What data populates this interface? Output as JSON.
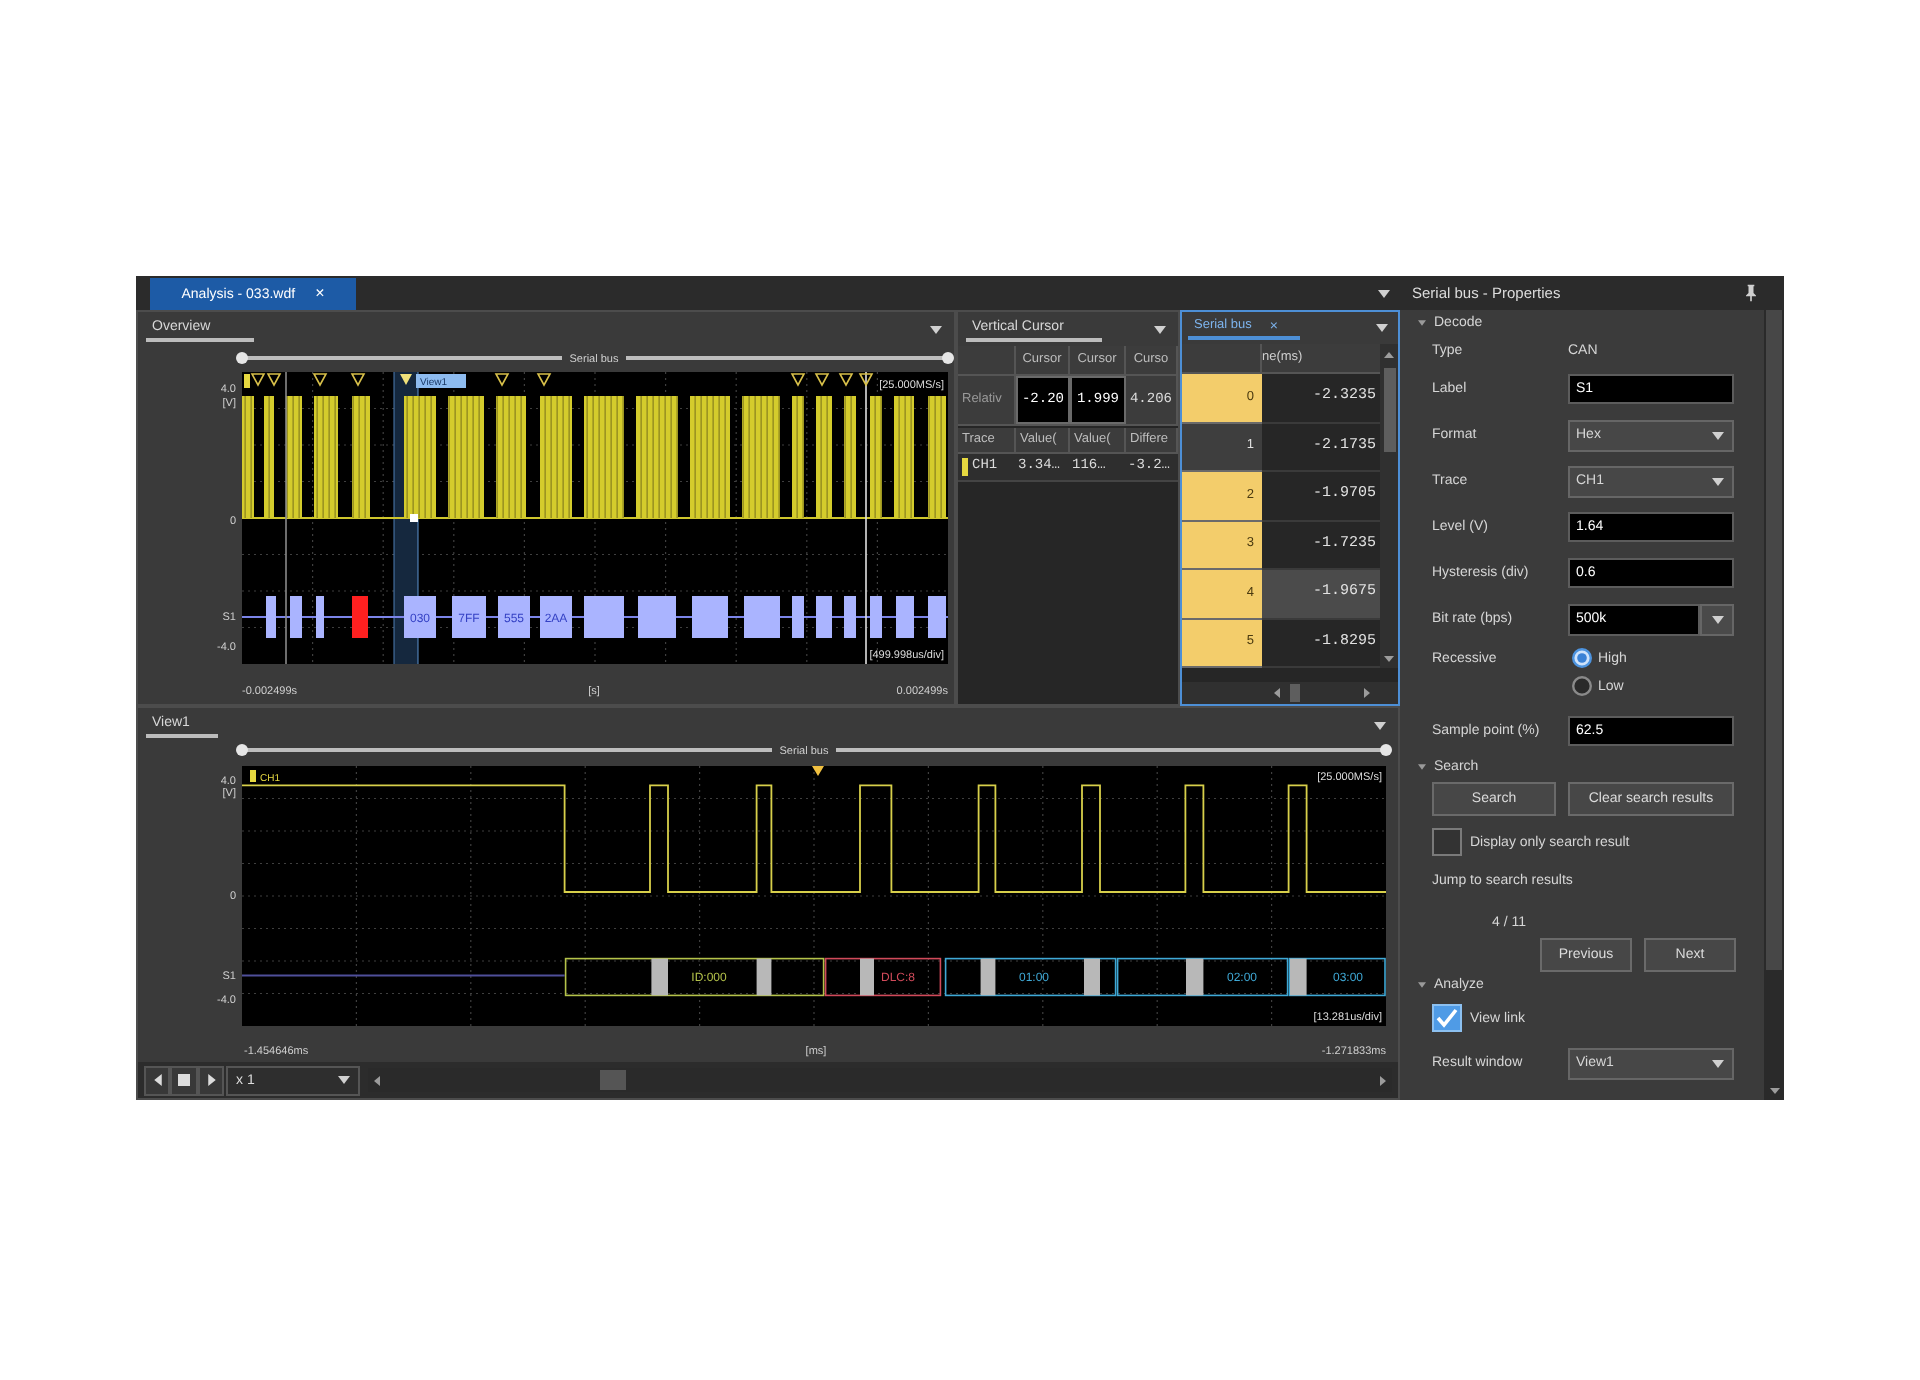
{
  "document_tabs": [
    {
      "label": "Analysis - 033.wdf",
      "close": "×",
      "selected": true
    }
  ],
  "overview": {
    "tab": "Overview",
    "bus_label": "Serial bus",
    "y_labels": [
      "4.0",
      "[V]",
      "0",
      "S1",
      "-4.0"
    ],
    "sample_rate": "[25.000MS/s]",
    "time_div": "[499.998us/div]",
    "cursor_tag": "View1",
    "x_labels": [
      "-0.002499s",
      "[s]",
      "0.002499s"
    ],
    "frames": [
      {
        "color": "#aab4ff"
      },
      {
        "color": "#aab4ff"
      },
      {
        "color": "#aab4ff"
      },
      {
        "color": "#ff2020"
      },
      {
        "label": "030",
        "color": "#aab4ff"
      },
      {
        "label": "7FF",
        "color": "#aab4ff"
      },
      {
        "label": "555",
        "color": "#aab4ff"
      },
      {
        "label": "2AA",
        "color": "#aab4ff"
      },
      {
        "color": "#aab4ff"
      },
      {
        "color": "#aab4ff"
      },
      {
        "color": "#aab4ff"
      },
      {
        "color": "#aab4ff"
      },
      {
        "color": "#aab4ff"
      },
      {
        "color": "#aab4ff"
      },
      {
        "color": "#aab4ff"
      },
      {
        "color": "#aab4ff"
      },
      {
        "color": "#aab4ff"
      },
      {
        "color": "#aab4ff"
      }
    ]
  },
  "vertical_cursor": {
    "tab": "Vertical Cursor",
    "cursor_columns": [
      "Cursor",
      "Cursor",
      "Curso"
    ],
    "cursor_rows": [
      {
        "label": "Relativ",
        "cells": [
          {
            "text": "-2.20",
            "selected": true
          },
          {
            "text": "1.999",
            "selected": true
          },
          {
            "text": "4.206",
            "selected": false
          }
        ]
      }
    ],
    "trace_columns": [
      "Trace",
      "Value(",
      "Value(",
      "Differe"
    ],
    "trace_rows": [
      {
        "trace": "CH1",
        "color": "#e6d840",
        "cells": [
          "3.34…",
          "116…",
          "-3.2…"
        ]
      }
    ]
  },
  "serial_bus": {
    "tab": "Serial bus",
    "close": "×",
    "column": "ne(ms)",
    "rows": [
      {
        "index": "0",
        "time": "-2.3235",
        "focused": false,
        "selected": false
      },
      {
        "index": "1",
        "time": "-2.1735",
        "focused": true,
        "selected": false
      },
      {
        "index": "2",
        "time": "-1.9705",
        "focused": false,
        "selected": false
      },
      {
        "index": "3",
        "time": "-1.7235",
        "focused": false,
        "selected": false
      },
      {
        "index": "4",
        "time": "-1.9675",
        "focused": false,
        "selected": true
      },
      {
        "index": "5",
        "time": "-1.8295",
        "focused": false,
        "selected": false
      }
    ]
  },
  "view1": {
    "tab": "View1",
    "bus_label": "Serial bus",
    "y_labels": [
      "4.0",
      "[V]",
      "0",
      "S1",
      "-4.0"
    ],
    "trace_label": "CH1",
    "sample_rate": "[25.000MS/s]",
    "time_div": "[13.281us/div]",
    "x_labels": [
      "-1.454646ms",
      "[ms]",
      "-1.271833ms"
    ],
    "frames": [
      {
        "label": "ID:000",
        "color": "#b4c24a"
      },
      {
        "label": "DLC:8",
        "color": "#d04a5a"
      },
      {
        "label": "01:00",
        "color": "#3fa9d6"
      },
      {
        "label": "02:00",
        "color": "#3fa9d6"
      },
      {
        "label": "03:00",
        "color": "#3fa9d6"
      }
    ]
  },
  "view_toolbar": {
    "zoom": "x 1"
  },
  "properties": {
    "title": "Serial bus - Properties",
    "sections": [
      {
        "title": "Decode",
        "expanded": true,
        "rows": [
          {
            "kind": "text",
            "label": "Type",
            "value": "CAN"
          },
          {
            "kind": "input",
            "label": "Label",
            "value": "S1"
          },
          {
            "kind": "select",
            "label": "Format",
            "value": "Hex"
          },
          {
            "kind": "select",
            "label": "Trace",
            "value": "CH1"
          },
          {
            "kind": "input",
            "label": "Level (V)",
            "value": "1.64"
          },
          {
            "kind": "input",
            "label": "Hysteresis (div)",
            "value": "0.6"
          },
          {
            "kind": "combo",
            "label": "Bit rate (bps)",
            "value": "500k"
          },
          {
            "kind": "radio",
            "label": "Recessive",
            "options": [
              {
                "label": "High",
                "selected": true
              },
              {
                "label": "Low",
                "selected": false
              }
            ]
          },
          {
            "kind": "input",
            "label": "Sample point (%)",
            "value": "62.5"
          }
        ]
      },
      {
        "title": "Search",
        "expanded": true,
        "rows": [
          {
            "kind": "buttons",
            "buttons": [
              "Search",
              "Clear search results"
            ]
          },
          {
            "kind": "checkbox",
            "label": "Display only search result",
            "checked": false
          },
          {
            "kind": "note",
            "label": "Jump to search results"
          },
          {
            "kind": "pager",
            "count": "4 / 11",
            "buttons": [
              "Previous",
              "Next"
            ]
          }
        ]
      },
      {
        "title": "Analyze",
        "expanded": true,
        "rows": [
          {
            "kind": "checkbox",
            "label": "View link",
            "checked": true
          },
          {
            "kind": "select",
            "label": "Result window",
            "value": "View1"
          }
        ]
      }
    ]
  }
}
